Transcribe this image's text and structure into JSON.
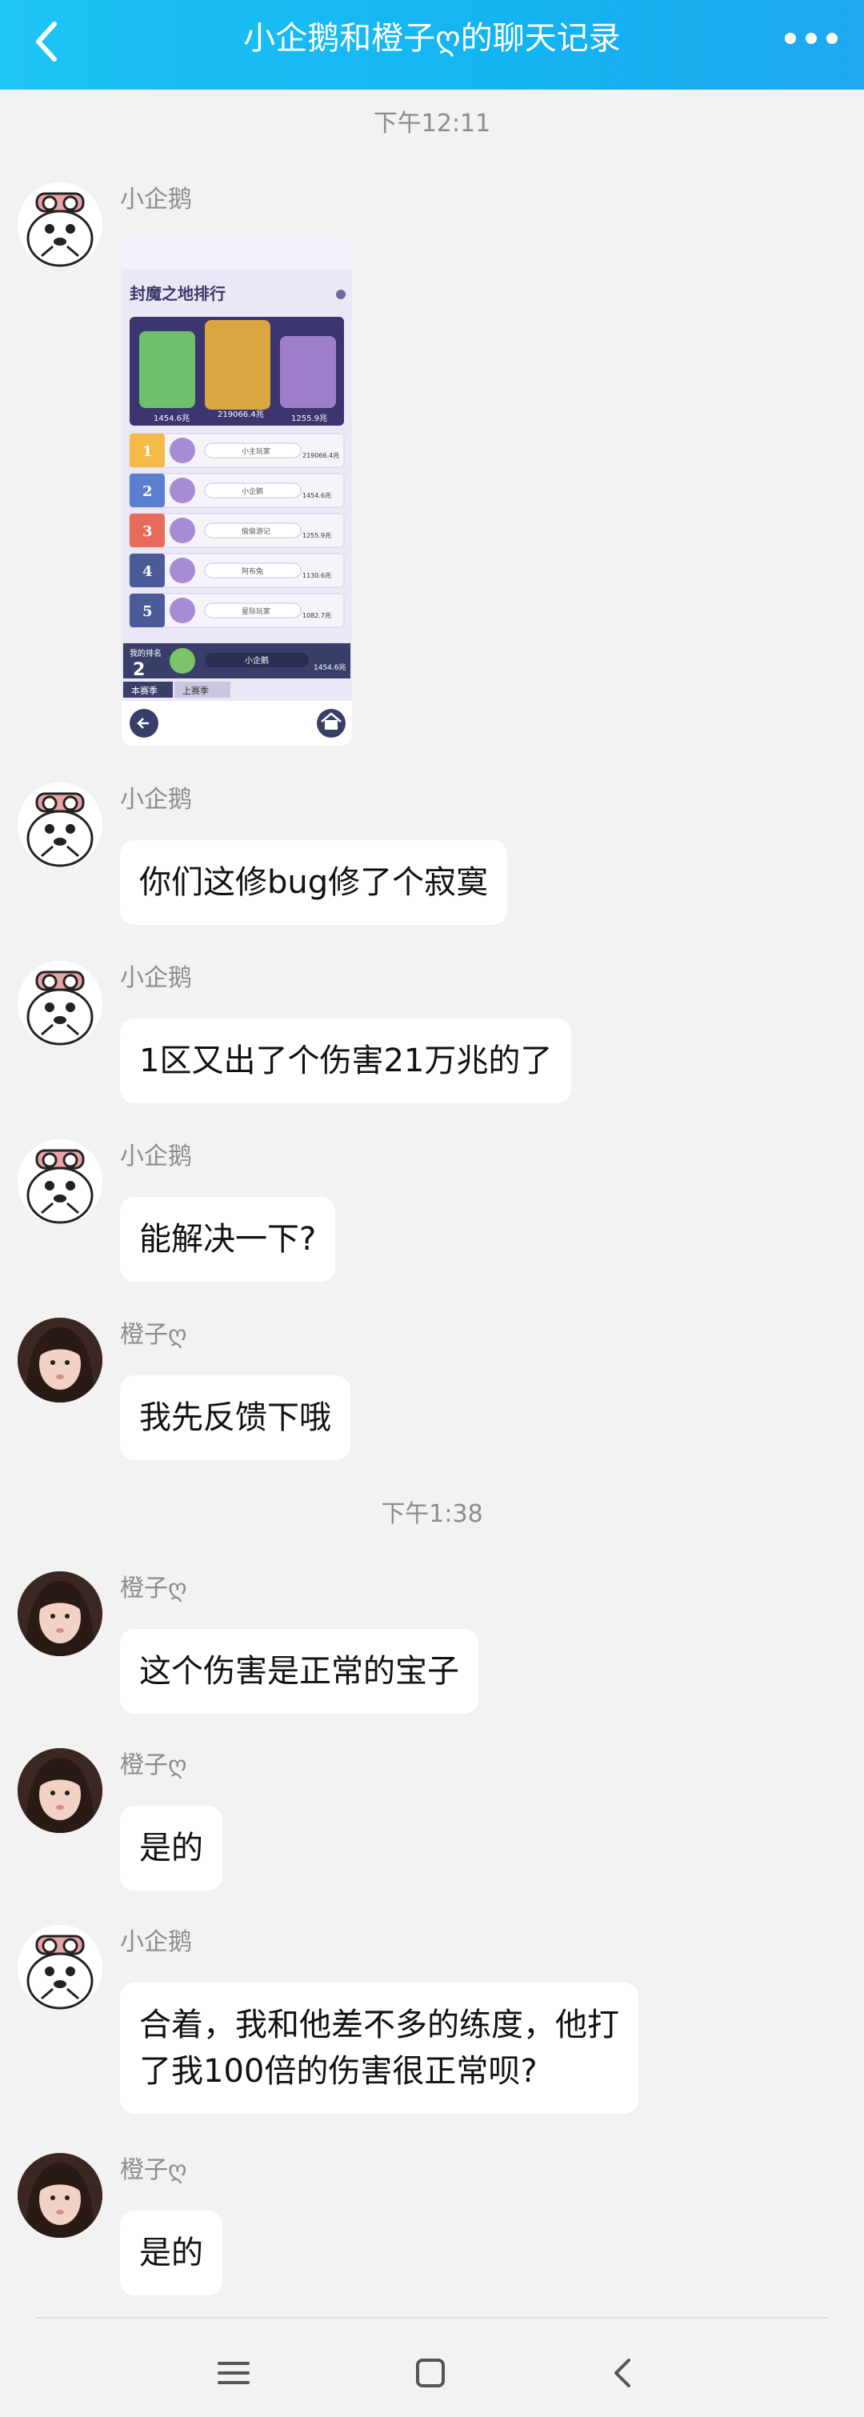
{
  "header": {
    "title": "小企鹅和橙子ღ的聊天记录",
    "accent_color": "#1ab8f3"
  },
  "timestamps": [
    "下午12:11",
    "下午1:38"
  ],
  "image_message": {
    "sender": "小企鹅",
    "ranking": {
      "title": "封魔之地排行",
      "podium": [
        {
          "rank": 1,
          "value": "219066.4兆"
        },
        {
          "rank": 2,
          "value": "1454.6兆"
        },
        {
          "rank": 3,
          "value": "1255.9兆"
        }
      ],
      "rows": [
        {
          "rank": "1",
          "name": "小主玩家",
          "value": "219066.4兆",
          "color": "#f5b94a"
        },
        {
          "rank": "2",
          "name": "小企鹅",
          "value": "1454.6兆",
          "color": "#5a7fd1"
        },
        {
          "rank": "3",
          "name": "偷偷游记",
          "value": "1255.9兆",
          "color": "#e86a5a"
        },
        {
          "rank": "4",
          "name": "阿布兔",
          "value": "1130.6兆",
          "color": "#4b5b9a"
        },
        {
          "rank": "5",
          "name": "星际玩家",
          "value": "1082.7兆",
          "color": "#4b5b9a"
        }
      ],
      "my_rank_label": "我的排名",
      "my_rank": "2",
      "my_name": "小企鹅",
      "my_value": "1454.6兆",
      "tabs": [
        "本赛季",
        "上赛季"
      ]
    }
  },
  "messages": [
    {
      "sender": "小企鹅",
      "avatar": "penguin",
      "text": "你们这修bug修了个寂寞"
    },
    {
      "sender": "小企鹅",
      "avatar": "penguin",
      "text": "1区又出了个伤害21万兆的了"
    },
    {
      "sender": "小企鹅",
      "avatar": "penguin",
      "text": "能解决一下?"
    },
    {
      "sender": "橙子ღ",
      "avatar": "girl",
      "text": "我先反馈下哦"
    },
    {
      "sender": "橙子ღ",
      "avatar": "girl",
      "text": "这个伤害是正常的宝子"
    },
    {
      "sender": "橙子ღ",
      "avatar": "girl",
      "text": "是的"
    },
    {
      "sender": "小企鹅",
      "avatar": "penguin",
      "text": "合着，我和他差不多的练度，他打\n了我100倍的伤害很正常呗?"
    },
    {
      "sender": "橙子ღ",
      "avatar": "girl",
      "text": "是的"
    }
  ],
  "icons": {
    "back": "back-arrow-icon",
    "more": "more-dots-icon",
    "nav_menu": "menu-lines-icon",
    "nav_home": "home-square-icon",
    "nav_back": "nav-back-icon"
  }
}
